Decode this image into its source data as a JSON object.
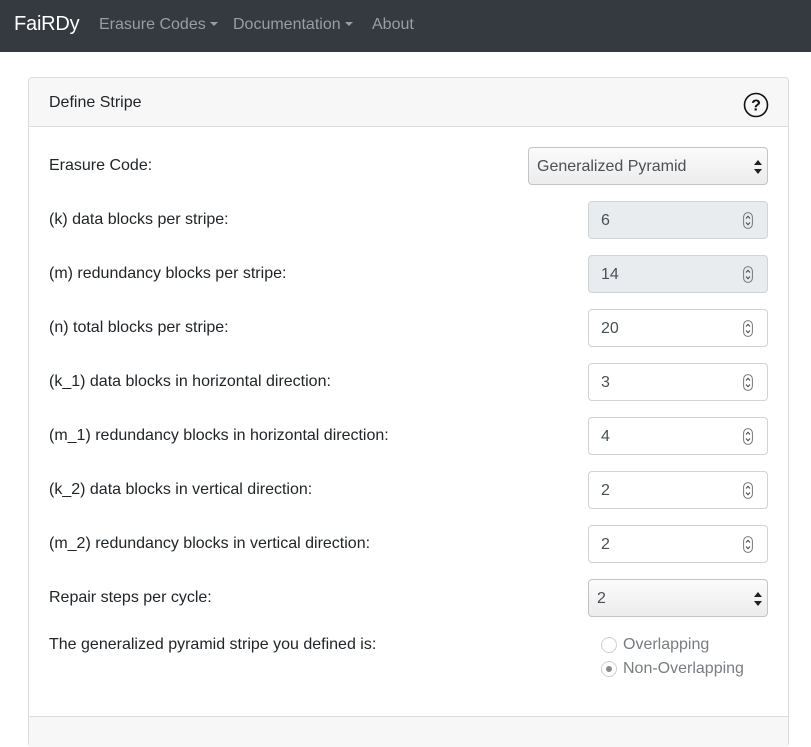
{
  "navbar": {
    "brand": "FaiRDy",
    "items": [
      {
        "label": "Erasure Codes",
        "dropdown": true
      },
      {
        "label": "Documentation",
        "dropdown": true
      },
      {
        "label": "About",
        "dropdown": false
      }
    ]
  },
  "card": {
    "title": "Define Stripe",
    "help_icon": "question-circle-icon"
  },
  "form": {
    "erasure_code": {
      "label": "Erasure Code:",
      "value": "Generalized Pyramid"
    },
    "k": {
      "label": "(k) data blocks per stripe:",
      "value": "6"
    },
    "m": {
      "label": "(m) redundancy blocks per stripe:",
      "value": "14"
    },
    "n": {
      "label": "(n) total blocks per stripe:",
      "value": "20"
    },
    "k1": {
      "label": "(k_1) data blocks in horizontal direction:",
      "value": "3"
    },
    "m1": {
      "label": "(m_1) redundancy blocks in horizontal direction:",
      "value": "4"
    },
    "k2": {
      "label": "(k_2) data blocks in vertical direction:",
      "value": "2"
    },
    "m2": {
      "label": "(m_2) redundancy blocks in vertical direction:",
      "value": "2"
    },
    "repair_steps": {
      "label": "Repair steps per cycle:",
      "value": "2"
    },
    "stripe_type": {
      "label": "The generalized pyramid stripe you defined is:",
      "options": [
        "Overlapping",
        "Non-Overlapping"
      ],
      "selected": "Non-Overlapping"
    }
  },
  "colors": {
    "navbar_bg": "#343a40",
    "nav_text": "#9a9da1",
    "disabled_input_bg": "#e9ecef"
  }
}
